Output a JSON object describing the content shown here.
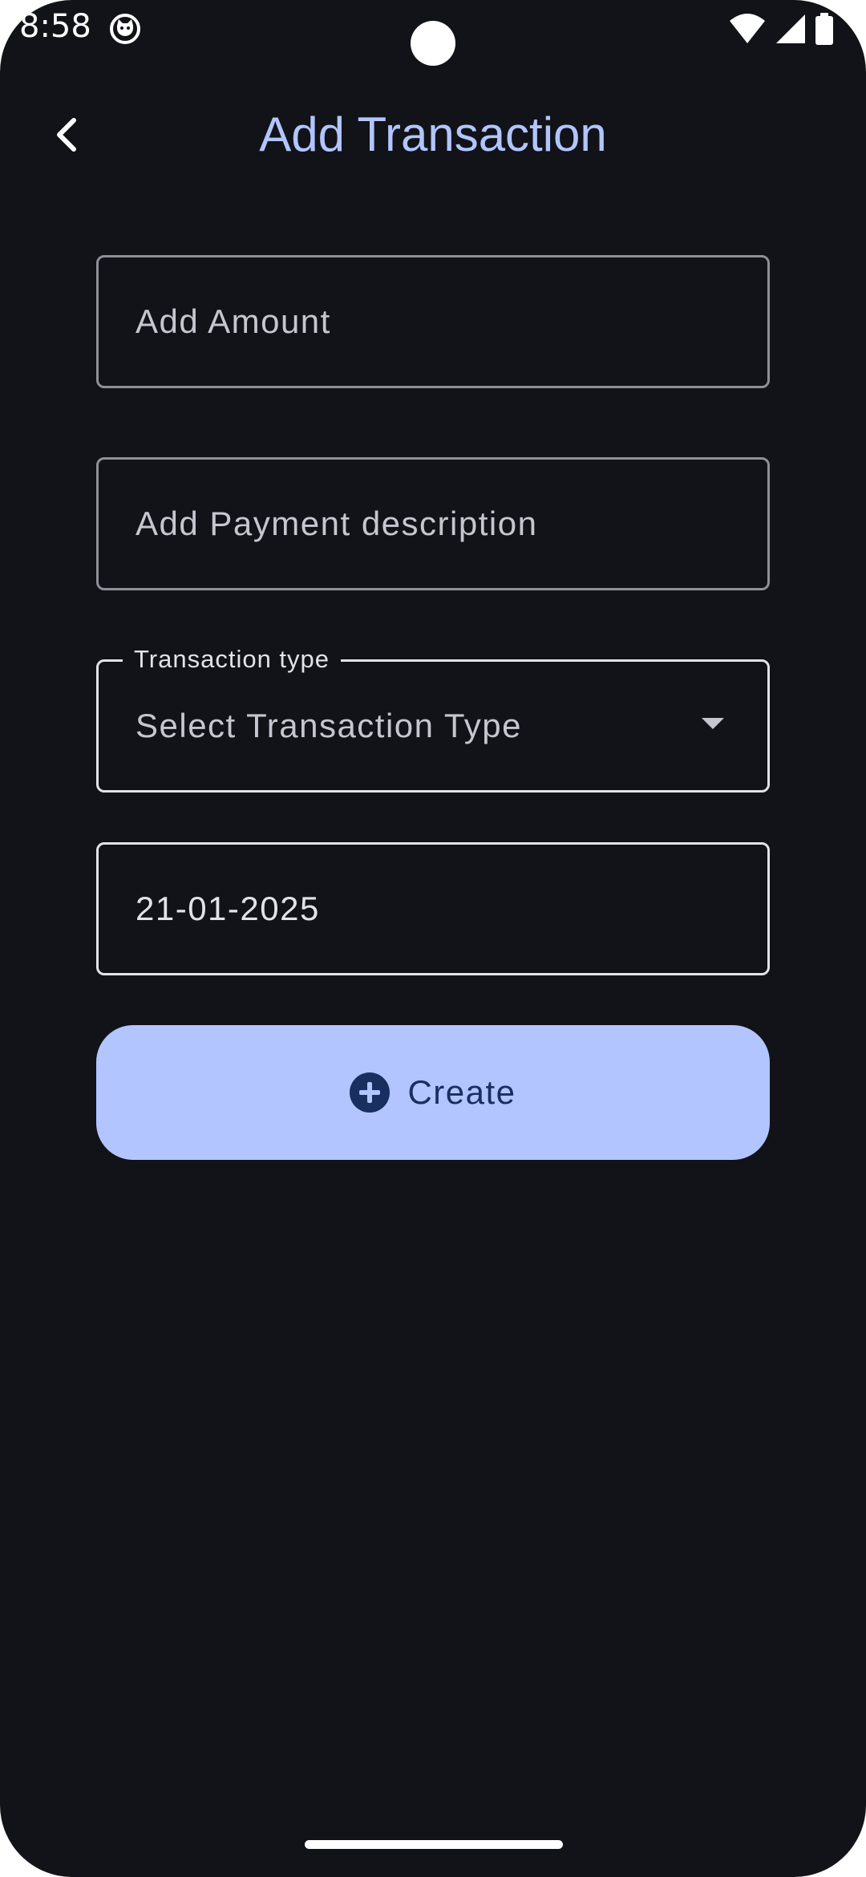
{
  "status_bar": {
    "time": "8:58",
    "notification_icon": "cat-face-icon",
    "icons": [
      "wifi-icon",
      "cellular-signal-icon",
      "battery-icon"
    ]
  },
  "header": {
    "back_icon": "chevron-left-icon",
    "title": "Add Transaction"
  },
  "form": {
    "amount": {
      "placeholder": "Add Amount",
      "value": ""
    },
    "description": {
      "placeholder": "Add Payment description",
      "value": ""
    },
    "transaction_type": {
      "label": "Transaction type",
      "selected": "Select Transaction Type",
      "icon": "dropdown-arrow-icon"
    },
    "date": {
      "value": "21-01-2025"
    },
    "create_button": {
      "label": "Create",
      "icon": "add-circle-icon"
    }
  },
  "colors": {
    "background": "#121318",
    "accent": "#b2c5ff",
    "on_accent": "#182f60",
    "outline": "#8e9099",
    "text": "#e3e2e9"
  }
}
